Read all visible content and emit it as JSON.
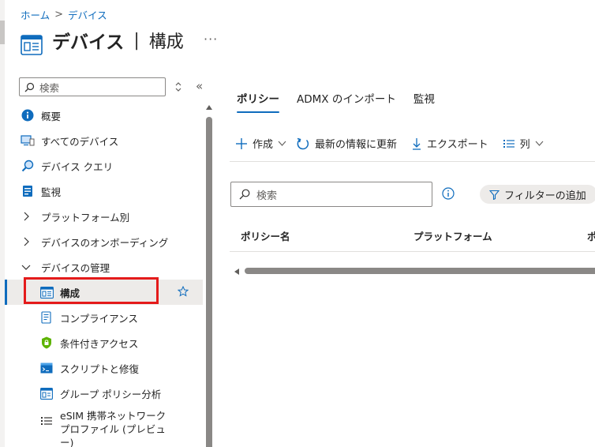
{
  "breadcrumb": {
    "home": "ホーム",
    "separator": ">",
    "current": "デバイス"
  },
  "header": {
    "title": "デバイス",
    "divider": "|",
    "subtitle": "構成",
    "more": "···",
    "icon": "device-config-icon"
  },
  "sidebar": {
    "search_placeholder": "検索",
    "collapse": "«",
    "items": [
      {
        "label": "概要",
        "icon": "info-icon"
      },
      {
        "label": "すべてのデバイス",
        "icon": "devices-icon"
      },
      {
        "label": "デバイス クエリ",
        "icon": "device-query-icon"
      },
      {
        "label": "監視",
        "icon": "monitor-icon"
      },
      {
        "label": "プラットフォーム別",
        "icon": "chevron-right-icon"
      },
      {
        "label": "デバイスのオンボーディング",
        "icon": "chevron-right-icon"
      },
      {
        "label": "デバイスの管理",
        "icon": "chevron-down-icon"
      },
      {
        "label": "構成",
        "icon": "configuration-icon",
        "active": true
      },
      {
        "label": "コンプライアンス",
        "icon": "compliance-icon"
      },
      {
        "label": "条件付きアクセス",
        "icon": "lock-shield-icon"
      },
      {
        "label": "スクリプトと修復",
        "icon": "script-icon"
      },
      {
        "label": "グループ ポリシー分析",
        "icon": "group-policy-icon"
      },
      {
        "label": "eSIM 携帯ネットワーク プロファイル (プレビュー)",
        "icon": "list-icon"
      }
    ]
  },
  "tabs": [
    {
      "label": "ポリシー",
      "active": true
    },
    {
      "label": "ADMX のインポート"
    },
    {
      "label": "監視"
    }
  ],
  "toolbar": {
    "create": "作成",
    "refresh": "最新の情報に更新",
    "export": "エクスポート",
    "columns": "列"
  },
  "search": {
    "placeholder": "検索"
  },
  "filter": {
    "label": "フィルターの追加"
  },
  "table": {
    "columns": [
      "ポリシー名",
      "プラットフォーム",
      "ポ"
    ]
  },
  "colors": {
    "accent": "#0f6cbd",
    "highlight": "#e41b1b"
  }
}
